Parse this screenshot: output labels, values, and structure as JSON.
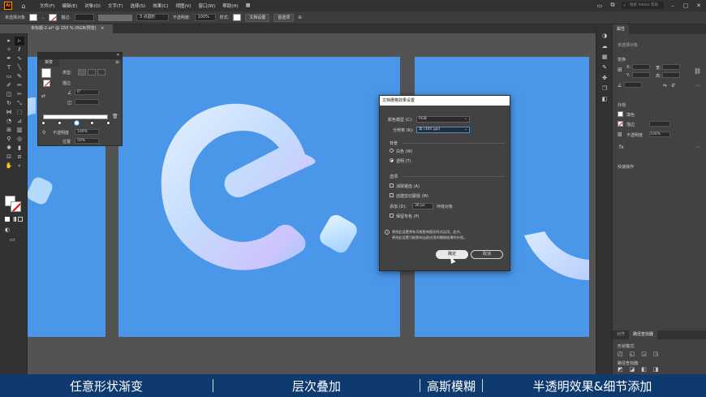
{
  "menubar": {
    "logo": "Ai",
    "items": [
      "文件(F)",
      "编辑(E)",
      "对象(O)",
      "文字(T)",
      "选择(S)",
      "效果(C)",
      "视图(V)",
      "窗口(W)",
      "帮助(H)"
    ],
    "search_placeholder": "搜索 Adobe 帮助"
  },
  "controlbar": {
    "selection_label": "未选择对象",
    "stroke_label": "描边:",
    "brush_value": "3 点圆形",
    "opacity_label": "不透明度:",
    "opacity_value": "100%",
    "style_label": "样式:",
    "doc_setup_button": "文档设置",
    "preferences_button": "首选项"
  },
  "document_tab": {
    "title": "未标题-2.ai* @ 150 % (RGB/预览)",
    "close": "×"
  },
  "gradient_panel": {
    "tab_label": "渐变",
    "type_label": "类型:",
    "angle_value": "0°",
    "opacity_label": "不透明度",
    "opacity_value": "100%",
    "position_label": "位置",
    "position_value": "50%"
  },
  "dialog": {
    "title": "文档栅格效果设置",
    "color_model_label": "颜色模型 (C):",
    "color_model_value": "RGB",
    "resolution_label": "分辨率 (R):",
    "resolution_value": "高 (300 ppi)",
    "background_heading": "背景",
    "bg_white": "白色 (W)",
    "bg_transparent": "透明 (T)",
    "options_heading": "选项",
    "opt_antialias": "消除锯齿 (A)",
    "opt_clipmask": "创建剪切蒙版 (M)",
    "add_label": "添加 (D):",
    "add_value": "36 px",
    "add_suffix": "环绕对象",
    "opt_spot": "保留专色 (P)",
    "info_text_1": "更改此设置将有可能影响图形样式运用，此外，",
    "info_text_2": "更改此设置可能影响当前应用的栅格效果的外观。",
    "ok_button": "确定",
    "cancel_button": "取消"
  },
  "right_panel": {
    "tabs": [
      "属性",
      "图层",
      "库"
    ],
    "no_selection": "未选择对象",
    "transform_heading": "变换",
    "appearance_heading": "外观",
    "fill_label": "填色",
    "stroke_label": "描边",
    "opacity_label": "不透明度",
    "opacity_value": "100%",
    "quick_actions_heading": "快速操作",
    "bottom_tabs": [
      "对齐",
      "路径查找器"
    ],
    "shape_modes": "形状模式:",
    "pathfinder_label": "路径查找器:"
  },
  "subtitles": [
    "任意形状渐变",
    "层次叠加",
    "高斯模糊",
    "半透明效果&细节添加"
  ],
  "colors": {
    "artboard": "#4a97ea",
    "subtitle_bg": "#0e3a70",
    "ui_dark": "#323232",
    "ui_mid": "#424242",
    "workspace": "#535353"
  }
}
